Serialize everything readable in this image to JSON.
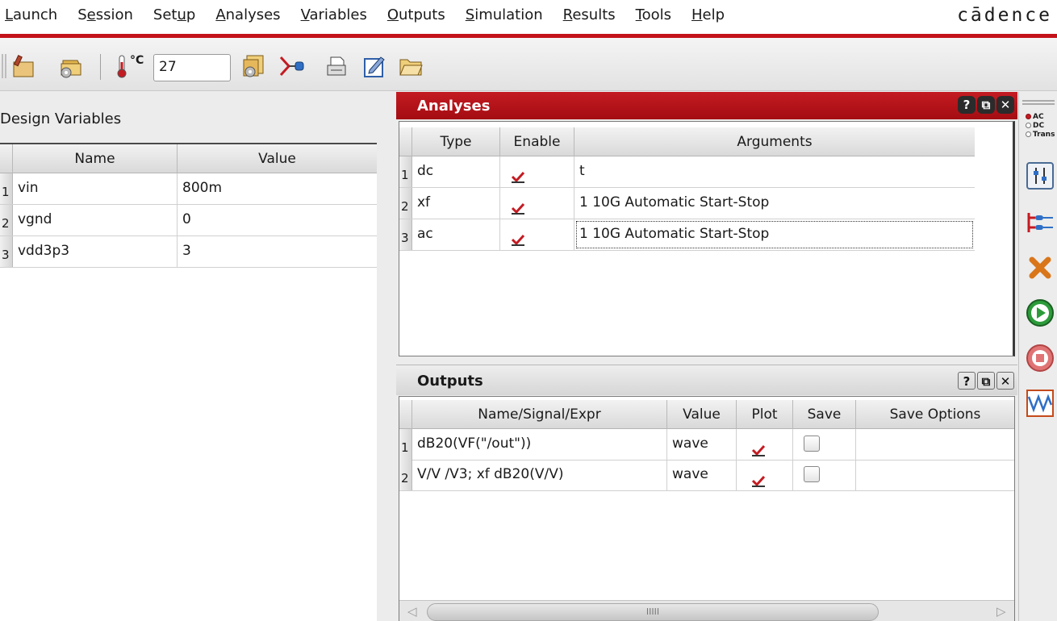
{
  "menubar": {
    "items": [
      {
        "label": "Launch",
        "accel": "L",
        "rest": "aunch"
      },
      {
        "label": "Session",
        "pre": "S",
        "accel": "e",
        "rest": "ssion"
      },
      {
        "label": "Setup",
        "pre": "Set",
        "accel": "u",
        "rest": "p"
      },
      {
        "label": "Analyses",
        "pre": "",
        "accel": "A",
        "rest": "nalyses"
      },
      {
        "label": "Variables",
        "pre": "",
        "accel": "V",
        "rest": "ariables"
      },
      {
        "label": "Outputs",
        "pre": "",
        "accel": "O",
        "rest": "utputs"
      },
      {
        "label": "Simulation",
        "pre": "",
        "accel": "S",
        "rest": "imulation"
      },
      {
        "label": "Results",
        "pre": "",
        "accel": "R",
        "rest": "esults"
      },
      {
        "label": "Tools",
        "pre": "",
        "accel": "T",
        "rest": "ools"
      },
      {
        "label": "Help",
        "pre": "",
        "accel": "H",
        "rest": "elp"
      }
    ],
    "brand": "cādence",
    "accent_color": "#c4121a"
  },
  "toolbar": {
    "temperature_unit": "°C",
    "temperature_value": "27",
    "icons": [
      "edit-session-icon",
      "setup-simulator-icon",
      "temperature-icon",
      "setup-model-icon",
      "probe-pin-icon",
      "print-icon",
      "edit-form-icon",
      "open-folder-icon"
    ]
  },
  "design_variables": {
    "title": "Design Variables",
    "columns": [
      "Name",
      "Value"
    ],
    "rows": [
      {
        "num": "1",
        "name": "vin",
        "value": "800m"
      },
      {
        "num": "2",
        "name": "vgnd",
        "value": "0"
      },
      {
        "num": "3",
        "name": "vdd3p3",
        "value": "3"
      }
    ]
  },
  "analyses": {
    "title": "Analyses",
    "buttons": [
      "?",
      "⧉",
      "✕"
    ],
    "columns": [
      "Type",
      "Enable",
      "Arguments"
    ],
    "rows": [
      {
        "num": "1",
        "type": "dc",
        "enabled": true,
        "arguments": "t"
      },
      {
        "num": "2",
        "type": "xf",
        "enabled": true,
        "arguments": "1 10G Automatic Start-Stop"
      },
      {
        "num": "3",
        "type": "ac",
        "enabled": true,
        "arguments": "1 10G Automatic Start-Stop"
      }
    ]
  },
  "outputs": {
    "title": "Outputs",
    "buttons": [
      "?",
      "⧉",
      "✕"
    ],
    "columns": [
      "Name/Signal/Expr",
      "Value",
      "Plot",
      "Save",
      "Save Options"
    ],
    "rows": [
      {
        "num": "1",
        "name": "dB20(VF(\"/out\"))",
        "value": "wave",
        "plot": true,
        "save": false,
        "save_options": ""
      },
      {
        "num": "2",
        "name": "V/V /V3; xf dB20(V/V)",
        "value": "wave",
        "plot": true,
        "save": false,
        "save_options": ""
      }
    ],
    "scroll_grip": "IIIII"
  },
  "dock": {
    "analysis_radio": [
      {
        "label": "AC",
        "selected": true
      },
      {
        "label": "DC",
        "selected": false
      },
      {
        "label": "Trans",
        "selected": false
      }
    ],
    "icons": [
      "parameter-sweep-icon",
      "netlist-icon",
      "delete-icon",
      "run-simulation-icon",
      "stop-simulation-icon",
      "plot-outputs-icon"
    ]
  }
}
